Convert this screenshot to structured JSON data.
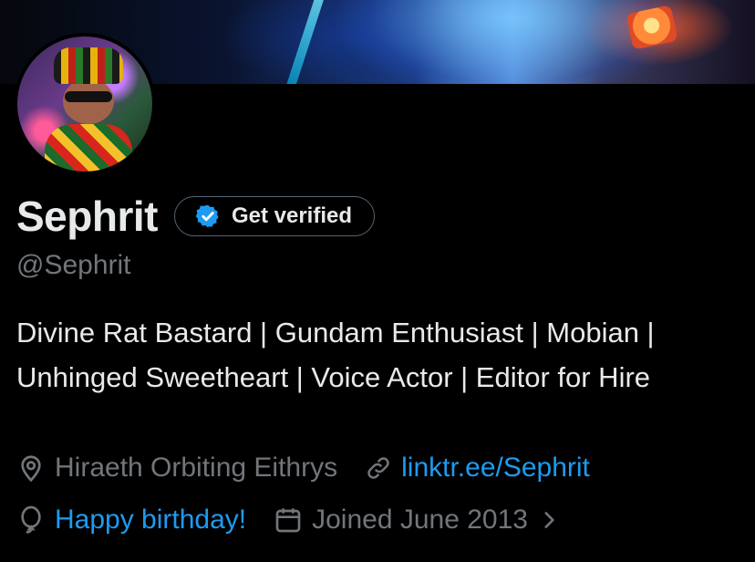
{
  "profile": {
    "display_name": "Sephrit",
    "handle": "@Sephrit",
    "get_verified_label": "Get verified",
    "bio": "Divine Rat Bastard | Gundam Enthusiast | Mobian | Unhinged Sweetheart | Voice Actor | Editor for Hire",
    "location": "Hiraeth Orbiting Eithrys",
    "website": "linktr.ee/Sephrit",
    "birthday": "Happy birthday!",
    "joined": "Joined June 2013"
  },
  "icons": {
    "verified": "verified-badge-icon",
    "location": "location-pin-icon",
    "link": "link-icon",
    "birthday": "balloon-icon",
    "calendar": "calendar-icon",
    "chevron": "chevron-right-icon"
  },
  "colors": {
    "background": "#000000",
    "text": "#e7e9ea",
    "muted": "#71767b",
    "accent": "#1d9bf0"
  }
}
